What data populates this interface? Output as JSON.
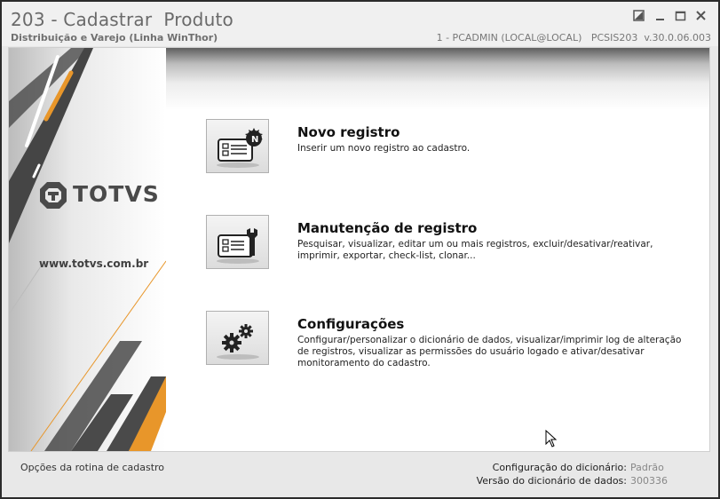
{
  "window": {
    "title": "203 - Cadastrar  Produto",
    "subtitle": "Distribuição e Varejo (Linha WinThor)",
    "user_info": "1 - PCADMIN (LOCAL@LOCAL)   PCSIS203  v.30.0.06.003"
  },
  "sidebar": {
    "logo_text": "TOTVS",
    "website": "www.totvs.com.br",
    "accent_color": "#e8962a"
  },
  "options": [
    {
      "title": "Novo registro",
      "description": "Inserir um novo registro ao cadastro.",
      "icon": "new-record-icon"
    },
    {
      "title": "Manutenção de registro",
      "description": "Pesquisar, visualizar, editar um ou mais registros, excluir/desativar/reativar, imprimir, exportar, check-list,  clonar...",
      "icon": "maintenance-icon"
    },
    {
      "title": "Configurações",
      "description": "Configurar/personalizar o dicionário de dados, visualizar/imprimir log de alteração de registros, visualizar as permissões do usuário logado e ativar/desativar monitoramento do cadastro.",
      "icon": "gears-icon"
    }
  ],
  "footer": {
    "left_text": "Opções da rotina de cadastro",
    "dictionary_config_label": "Configuração do dicionário:",
    "dictionary_config_value": "Padrão",
    "dictionary_version_label": "Versão do dicionário de dados:",
    "dictionary_version_value": "300336"
  }
}
